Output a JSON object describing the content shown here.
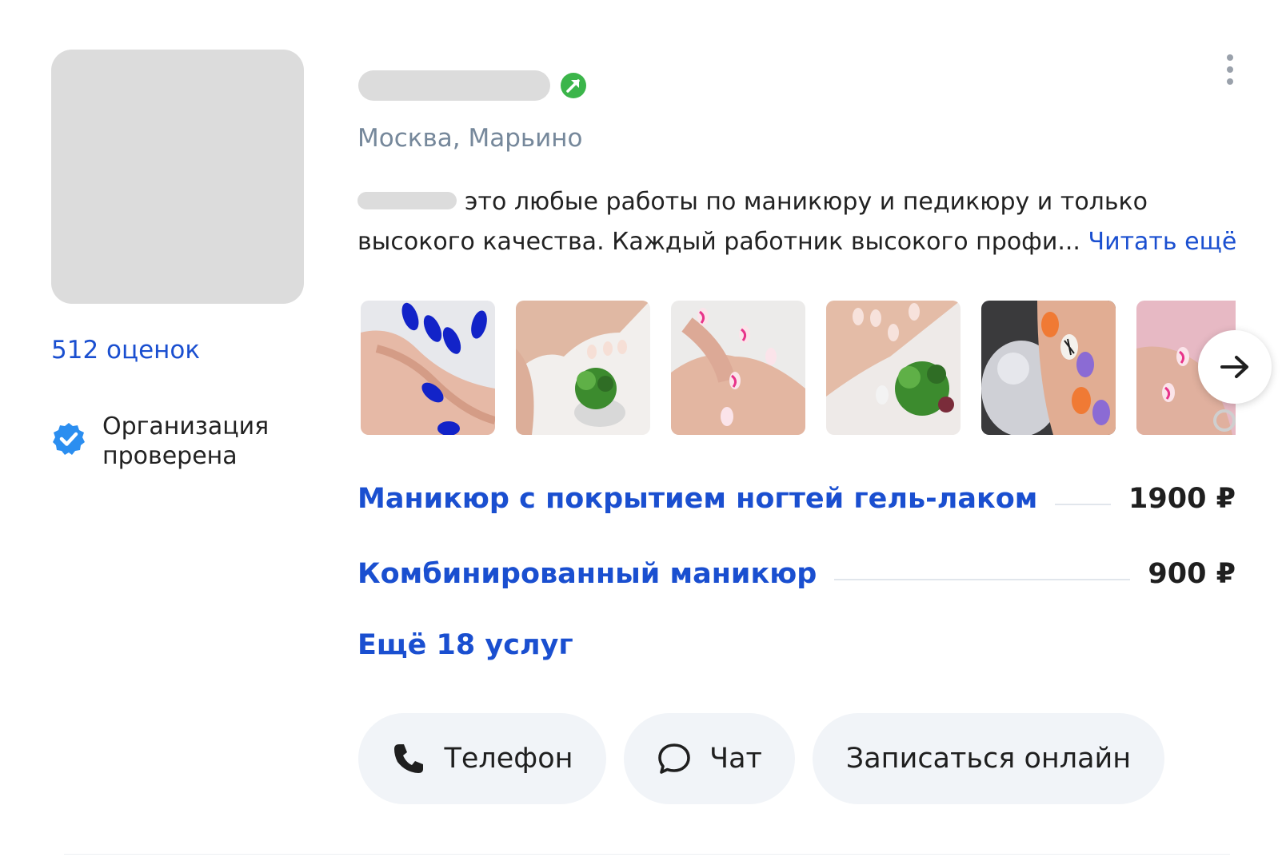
{
  "left": {
    "ratings_link": "512 оценок",
    "verified_label": "Организация проверена"
  },
  "header": {
    "location": "Москва, Марьино",
    "goal_icon": "green-arrow-icon",
    "menu_icon": "more-vertical-icon"
  },
  "description": {
    "text": "это любые работы по маникюру и педикюру и только высокого качества. Каждый работник высокого профи...",
    "read_more": "Читать ещё"
  },
  "gallery": {
    "photos": [
      "nails-blue",
      "nails-succulent",
      "nails-pink-wave",
      "nails-succulent-2",
      "nails-orange-purple",
      "nails-pink"
    ],
    "next_icon": "arrow-right-icon"
  },
  "services": {
    "items": [
      {
        "name": "Маникюр с покрытием ногтей гель-лаком",
        "price": "1900 ₽"
      },
      {
        "name": "Комбинированный маникюр",
        "price": "900 ₽"
      }
    ],
    "more_link": "Ещё 18 услуг"
  },
  "actions": {
    "phone_label": "Телефон",
    "chat_label": "Чат",
    "booking_label": "Записаться онлайн"
  },
  "colors": {
    "link": "#1a4fd0",
    "muted": "#76889b",
    "button_bg": "#f1f4f8",
    "verified": "#2b8ef0",
    "goal": "#3bb54a"
  }
}
